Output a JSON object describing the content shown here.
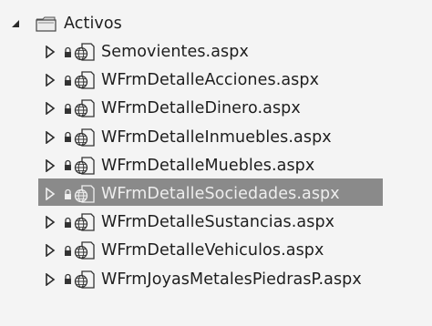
{
  "tree": {
    "folder": {
      "label": "Activos",
      "icon": "folder-icon",
      "expanded": true
    },
    "items": [
      {
        "label": "Semovientes.aspx",
        "selected": false
      },
      {
        "label": "WFrmDetalleAcciones.aspx",
        "selected": false
      },
      {
        "label": "WFrmDetalleDinero.aspx",
        "selected": false
      },
      {
        "label": "WFrmDetalleInmuebles.aspx",
        "selected": false
      },
      {
        "label": "WFrmDetalleMuebles.aspx",
        "selected": false
      },
      {
        "label": "WFrmDetalleSociedades.aspx",
        "selected": true
      },
      {
        "label": "WFrmDetalleSustancias.aspx",
        "selected": false
      },
      {
        "label": "WFrmDetalleVehiculos.aspx",
        "selected": false
      },
      {
        "label": "WFrmJoyasMetalesPiedrasP.aspx",
        "selected": false
      }
    ]
  },
  "colors": {
    "selection": "#8a8a8a",
    "text": "#1e1e1e"
  }
}
